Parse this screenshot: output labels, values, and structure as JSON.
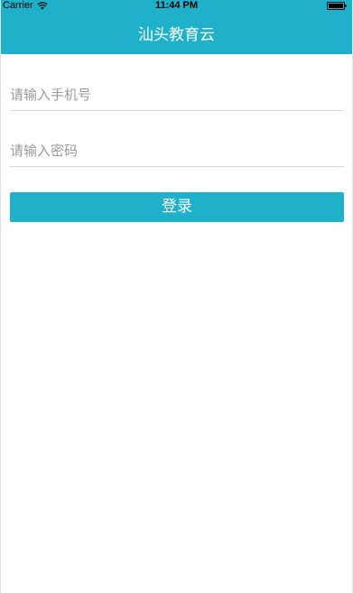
{
  "status_bar": {
    "carrier": "Carrier",
    "time": "11:44 PM",
    "wifi_icon": "wifi-icon",
    "battery_icon": "battery-icon"
  },
  "nav": {
    "title": "汕头教育云"
  },
  "form": {
    "phone_placeholder": "请输入手机号",
    "phone_value": "",
    "password_placeholder": "请输入密码",
    "password_value": "",
    "login_label": "登录"
  },
  "colors": {
    "accent": "#1fb1c9",
    "background": "#ffffff",
    "placeholder": "#9a9a9a",
    "divider": "#d9d9d9"
  }
}
